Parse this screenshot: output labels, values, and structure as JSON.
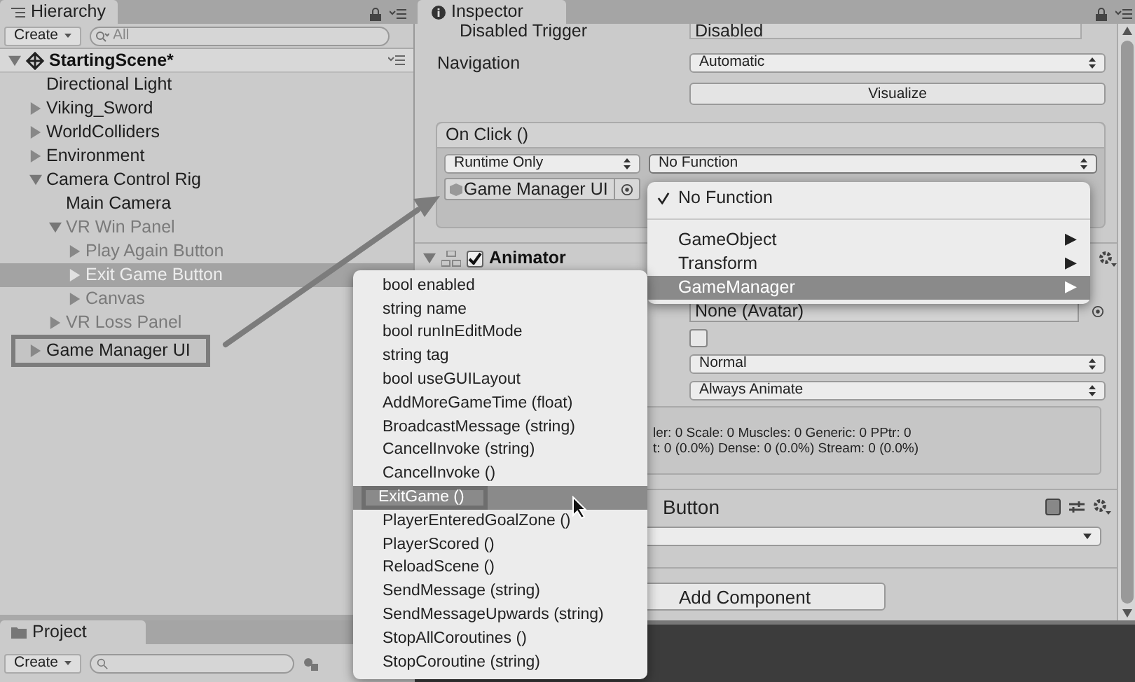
{
  "hierarchy": {
    "title": "Hierarchy",
    "create": "Create",
    "search": {
      "placeholder": "All"
    },
    "scene": {
      "name": "StartingScene*",
      "expanded": true
    },
    "items": [
      {
        "label": "Directional Light",
        "inactive": false,
        "selected": false,
        "outlined": false
      },
      {
        "label": "Viking_Sword",
        "expanded": false,
        "inactive": false,
        "selected": false,
        "outlined": false
      },
      {
        "label": "WorldColliders",
        "expanded": false,
        "inactive": false,
        "selected": false,
        "outlined": false
      },
      {
        "label": "Environment",
        "expanded": false,
        "inactive": false,
        "selected": false,
        "outlined": false
      },
      {
        "label": "Camera Control Rig",
        "expanded": true,
        "inactive": false,
        "selected": false,
        "outlined": false,
        "children": [
          {
            "label": "Main Camera",
            "inactive": false,
            "selected": false,
            "outlined": false
          },
          {
            "label": "VR Win Panel",
            "expanded": true,
            "inactive": true,
            "selected": false,
            "outlined": false,
            "children": [
              {
                "label": "Play Again Button",
                "expanded": false,
                "inactive": true,
                "selected": false,
                "outlined": false
              },
              {
                "label": "Exit Game Button",
                "expanded": false,
                "inactive": true,
                "selected": true,
                "outlined": false
              },
              {
                "label": "Canvas",
                "expanded": false,
                "inactive": true,
                "selected": false,
                "outlined": false
              }
            ]
          },
          {
            "label": "VR Loss Panel",
            "expanded": false,
            "inactive": true,
            "selected": false,
            "outlined": false
          }
        ]
      },
      {
        "label": "Game Manager UI",
        "expanded": false,
        "inactive": false,
        "selected": false,
        "outlined": true
      }
    ]
  },
  "project": {
    "title": "Project",
    "create": "Create"
  },
  "inspector": {
    "title": "Inspector",
    "disabled_trigger": {
      "label": "Disabled Trigger",
      "value": "Disabled"
    },
    "navigation": {
      "label": "Navigation",
      "value": "Automatic"
    },
    "visualize": "Visualize",
    "on_click": {
      "title": "On Click ()",
      "mode": "Runtime Only",
      "function": "No Function",
      "target": "Game Manager UI"
    },
    "animator": {
      "title": "Animator",
      "checked": true,
      "avatar": "None (Avatar)",
      "apply_root_motion": false,
      "update_mode": "Normal",
      "culling_mode": "Always Animate",
      "info": [
        "ler: 0 Scale: 0 Muscles: 0 Generic: 0 PPtr: 0",
        "t: 0 (0.0%) Dense: 0 (0.0%) Stream: 0 (0.0%)"
      ]
    },
    "button_component": {
      "title": "Button"
    },
    "add_component": "Add Component"
  },
  "function_menu": {
    "items": [
      {
        "kind": "check",
        "label": "No Function",
        "checked": true,
        "selected": false
      },
      {
        "kind": "separator"
      },
      {
        "kind": "submenu",
        "label": "GameObject",
        "arrow": "▶",
        "selected": false
      },
      {
        "kind": "submenu",
        "label": "Transform",
        "arrow": "▶",
        "selected": false
      },
      {
        "kind": "submenu",
        "label": "GameManager",
        "arrow": "▶",
        "selected": true
      }
    ]
  },
  "submenu": {
    "items": [
      {
        "label": "bool enabled",
        "selected": false,
        "outlined": false
      },
      {
        "label": "string name",
        "selected": false,
        "outlined": false
      },
      {
        "label": "bool runInEditMode",
        "selected": false,
        "outlined": false
      },
      {
        "label": "string tag",
        "selected": false,
        "outlined": false
      },
      {
        "label": "bool useGUILayout",
        "selected": false,
        "outlined": false
      },
      {
        "label": "AddMoreGameTime (float)",
        "selected": false,
        "outlined": false
      },
      {
        "label": "BroadcastMessage (string)",
        "selected": false,
        "outlined": false
      },
      {
        "label": "CancelInvoke (string)",
        "selected": false,
        "outlined": false
      },
      {
        "label": "CancelInvoke ()",
        "selected": false,
        "outlined": false
      },
      {
        "label": "ExitGame ()",
        "selected": true,
        "outlined": true
      },
      {
        "label": "PlayerEnteredGoalZone ()",
        "selected": false,
        "outlined": false
      },
      {
        "label": "PlayerScored ()",
        "selected": false,
        "outlined": false
      },
      {
        "label": "ReloadScene ()",
        "selected": false,
        "outlined": false
      },
      {
        "label": "SendMessage (string)",
        "selected": false,
        "outlined": false
      },
      {
        "label": "SendMessageUpwards (string)",
        "selected": false,
        "outlined": false
      },
      {
        "label": "StopAllCoroutines ()",
        "selected": false,
        "outlined": false
      },
      {
        "label": "StopCoroutine (string)",
        "selected": false,
        "outlined": false
      }
    ]
  }
}
